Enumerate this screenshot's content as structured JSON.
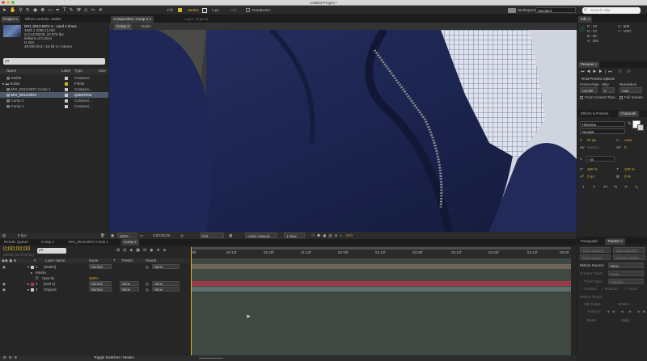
{
  "window": {
    "title": "Untitled Project *"
  },
  "toolbar": {
    "tools": [
      "select-tool",
      "hand-tool",
      "zoom-tool",
      "rotate-tool",
      "camera-tool",
      "pan-tool",
      "mask-tool",
      "pen-tool",
      "type-tool",
      "brush-tool",
      "clone-tool",
      "eraser-tool",
      "roto-tool",
      "puppet-tool"
    ],
    "fill_label": "Fill:",
    "stroke_label": "Stroke:",
    "stroke_width": "1 px",
    "add_label": "Add:",
    "roto_label": "RotoBezier",
    "workspace_label": "Workspace:",
    "workspace_value": "Standard",
    "search_placeholder": "Search Help"
  },
  "project_panel": {
    "tabs": [
      "Project ≡",
      "Effect Controls: Stable"
    ],
    "footage_name": "MVI_0013.MOV ▾ , used 4 times",
    "footage_info": [
      "1920 x 1080 (1.00)",
      "Δ 0;12;09;08, 23.976 fps",
      "Millions of Colors",
      "H.264",
      "48.000 kHz / 16 bit U / Stereo"
    ],
    "search_placeholder": "ρ▾",
    "columns": [
      "Name",
      "Label",
      "Type",
      "Size"
    ],
    "items": [
      {
        "name": "Stable",
        "color": "#c8c8c8",
        "type": "Composi...",
        "selected": false
      },
      {
        "name": "Solids",
        "color": "#d8b42a",
        "type": "Folder",
        "selected": false
      },
      {
        "name": "MVI_0013.MOV Comp 1",
        "color": "#c8c8c8",
        "type": "Composi...",
        "selected": false
      },
      {
        "name": "MVI_0013.MOV",
        "color": "#c8c8c8",
        "type": "QuickTime",
        "selected": true
      },
      {
        "name": "Comp 2",
        "color": "#c8c8c8",
        "type": "Composi...",
        "selected": false
      },
      {
        "name": "Comp 1",
        "color": "#c8c8c8",
        "type": "Composi...",
        "selected": false
      }
    ],
    "bpc": "8 bpc"
  },
  "comp_panel": {
    "tab": "Composition: Comp 2 ≡",
    "layer_tab": "Layer: Original",
    "sub_tabs": [
      "Comp 2",
      "Stable"
    ],
    "footer": {
      "zoom": "200%",
      "timecode": "0;00;00;00",
      "resolution": "Full",
      "camera": "Active Camera",
      "view": "1 View",
      "exposure": "+0.0"
    }
  },
  "info_panel": {
    "tab": "Info ≡",
    "r": "R : 34",
    "g": "G : 57",
    "b": "B : 56",
    "a": "A : 255",
    "x": "X : 608",
    "y": "Y : 1007"
  },
  "preview_panel": {
    "tab": "Preview ≡",
    "ram": "RAM Preview Options",
    "frame_rate_label": "Frame Rate",
    "skip_label": "Skip",
    "resolution_label": "Resolution",
    "frame_rate": "(23.98)",
    "skip": "0",
    "resolution": "Auto",
    "from_current": "From Current Time",
    "full_screen": "Full Screen"
  },
  "character_panel": {
    "tabs": [
      "Effects & Presets",
      "Character"
    ],
    "font": "Helvetica",
    "style": "Regular",
    "size": "57 px",
    "leading": "Auto",
    "kerning": "Metrics",
    "tracking": "0",
    "stroke": "- px",
    "vscale": "100 %",
    "hscale": "100 %",
    "baseline": "0 px",
    "tsume": "0 %",
    "styles": [
      "T",
      "T",
      "TT",
      "Tt",
      "T¹",
      "T₁"
    ]
  },
  "tracker_panel": {
    "tabs": [
      "Paragraph",
      "Tracker ≡"
    ],
    "track_camera": "Track Camera",
    "warp_stabilizer": "Warp Stabilizer",
    "track_motion": "Track Motion",
    "stabilize_motion": "Stabilize Motion",
    "motion_source_label": "Motion Source:",
    "motion_source": "None",
    "current_track_label": "Current Track:",
    "current_track": "None",
    "track_type_label": "Track Type:",
    "track_type": "Stabilize",
    "checks": [
      "✓ Position",
      "✓ Rotation",
      "✓ Scale"
    ],
    "motion_target": "Motion Target:",
    "edit_target": "Edit Target...",
    "options": "Options...",
    "analyze": "Analyze:",
    "reset": "Reset",
    "apply": "Apply"
  },
  "timeline": {
    "tabs": [
      "Render Queue",
      "Comp 1",
      "MVI_0013.MOV Comp 1",
      "Comp 2"
    ],
    "timecode": "0;00;00;00",
    "frame_info": "00000 (23.976 fps)",
    "search_placeholder": "ρ▾",
    "columns": [
      "#",
      "Layer Name",
      "Mode",
      "T",
      "TrkMat",
      "Parent"
    ],
    "layers": [
      {
        "num": "1",
        "name": "[Stable]",
        "mode": "Normal",
        "trkmat": "",
        "parent": "None",
        "color": "#c8c8c8"
      },
      {
        "num": "2",
        "name": "[Null 2]",
        "mode": "Normal",
        "trkmat": "None",
        "parent": "None",
        "color": "#a83a4a"
      },
      {
        "num": "3",
        "name": "Original",
        "mode": "Normal",
        "trkmat": "None",
        "parent": "None",
        "color": "#c8c8c8"
      }
    ],
    "masks_label": "Masks",
    "opacity_label": "Opacity",
    "opacity_value": "100%",
    "ruler_labels": [
      "00f",
      "00:12f",
      "01:00f",
      "01:12f",
      "02:00f",
      "02:12f",
      "03:00f",
      "03:12f",
      "04:00f",
      "04:12f",
      "05:00"
    ],
    "toggle_label": "Toggle Switches / Modes"
  },
  "colors": {
    "accent": "#d8b42a",
    "layer1_bar": "#6e6658",
    "layer2_bar": "#9a3a48",
    "layer3_bar": "#5f6e6a",
    "timeline_bg": "#3f4941"
  }
}
